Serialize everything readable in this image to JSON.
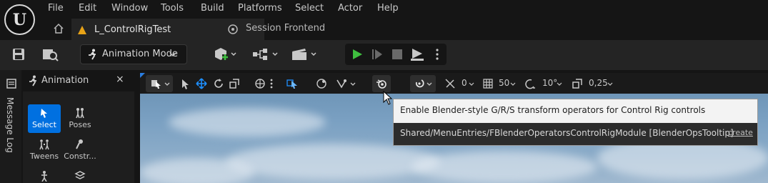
{
  "app": {
    "logo_text": "U"
  },
  "menu": [
    "File",
    "Edit",
    "Window",
    "Tools",
    "Build",
    "Platforms",
    "Select",
    "Actor",
    "Help"
  ],
  "tabs": {
    "active_label": "L_ControlRigTest",
    "second_label": "Session Frontend"
  },
  "toolbar": {
    "mode_label": "Animation Mode"
  },
  "left_strip": {
    "message_log": "Message Log"
  },
  "panel": {
    "title": "Animation",
    "close": "×",
    "tools": [
      {
        "label": "Select",
        "active": true
      },
      {
        "label": "Poses"
      },
      {
        "label": "Tweens"
      },
      {
        "label": "Constr..."
      }
    ]
  },
  "viewport_toolbar": {
    "translate_snap": "0",
    "grid_size": "50",
    "rotate_snap": "10°",
    "scale_snap": "0,25"
  },
  "tooltip": {
    "text": "Enable Blender-style G/R/S transform operators for Control Rig controls",
    "path": "Shared/MenuEntries/FBlenderOperatorsControlRigModule [BlenderOpsTooltip]",
    "create": "create"
  },
  "colors": {
    "accent": "#0070e0",
    "play_green": "#3fbf3f",
    "warning_orange": "#e8a317"
  },
  "icons": [
    "home-icon",
    "level-icon",
    "session-frontend-icon",
    "save-icon",
    "content-browser-icon",
    "running-man-icon",
    "add-actor-icon",
    "blueprint-icon",
    "cinematics-icon",
    "play-icon",
    "advance-frame-icon",
    "stop-icon",
    "eject-icon",
    "more-icon",
    "select-mode-icon",
    "arrow-icon",
    "move-icon",
    "rotate-icon",
    "scale-icon",
    "globe-icon",
    "blender-icon",
    "snap-icon",
    "grid-icon",
    "angle-icon",
    "scale-snap-icon",
    "cursor-icon"
  ]
}
